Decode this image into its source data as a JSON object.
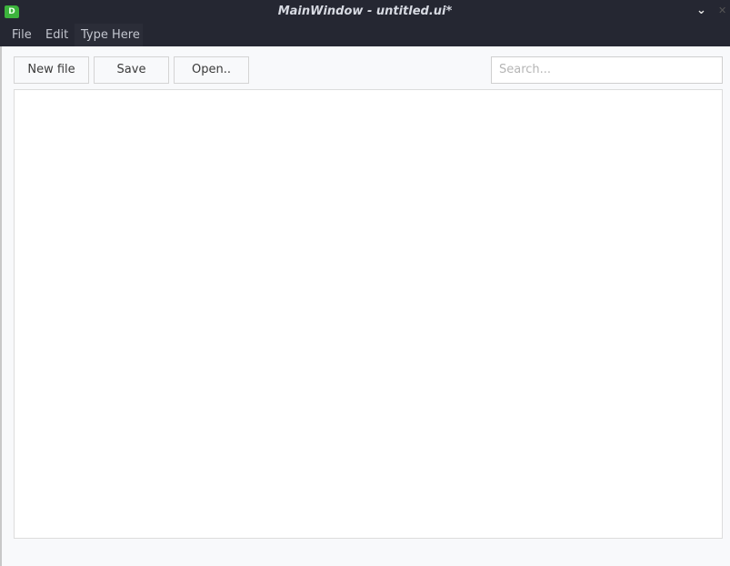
{
  "window": {
    "title": "MainWindow - untitled.ui*",
    "app_icon_letter": "D",
    "collapse_icon": "chevron-down",
    "close_icon": "close"
  },
  "menubar": {
    "items": [
      {
        "label": "File"
      },
      {
        "label": "Edit"
      },
      {
        "label": "Type Here"
      }
    ]
  },
  "toolbar": {
    "new_file_label": "New file",
    "save_label": "Save",
    "open_label": "Open.."
  },
  "search": {
    "value": "",
    "placeholder": "Search..."
  },
  "content": {
    "text": ""
  }
}
